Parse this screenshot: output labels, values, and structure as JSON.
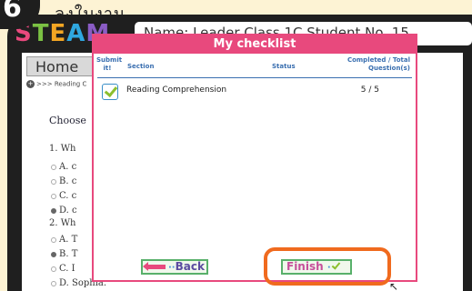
{
  "step": {
    "number": "6",
    "header_text": "ลงใบงาน"
  },
  "brand": {
    "logo_letters": [
      "S",
      "T",
      "E",
      "A",
      "M"
    ],
    "name_bar": "Name: Leader Class 1C Student No. 15"
  },
  "background_page": {
    "home_button": "Home",
    "breadcrumb": ">>> Reading C",
    "instruction": "Choose",
    "questions": [
      {
        "prompt": "1. Wh",
        "options": [
          {
            "text": "A. c",
            "selected": false
          },
          {
            "text": "B. c",
            "selected": false
          },
          {
            "text": "C. c",
            "selected": false
          },
          {
            "text": "D. c",
            "selected": true
          }
        ]
      },
      {
        "prompt": "2. Wh",
        "options": [
          {
            "text": "A. T",
            "selected": false
          },
          {
            "text": "B. T",
            "selected": true
          },
          {
            "text": "C. I",
            "selected": false
          },
          {
            "text": "D. Sophia.",
            "selected": false
          }
        ]
      }
    ]
  },
  "checklist": {
    "title": "My checklist",
    "headers": {
      "submit": "Submit it!",
      "section": "Section",
      "status": "Status",
      "completed": "Completed / Total Question(s)"
    },
    "rows": [
      {
        "checked": true,
        "section": "Reading Comprehension",
        "status": "",
        "completed": "5 / 5"
      }
    ],
    "back_label": "Back",
    "finish_label": "Finish"
  },
  "colors": {
    "accent_pink": "#e8497d",
    "highlight_orange": "#f06a1e",
    "button_green": "#58b06a",
    "check_green": "#8bbf2e"
  }
}
